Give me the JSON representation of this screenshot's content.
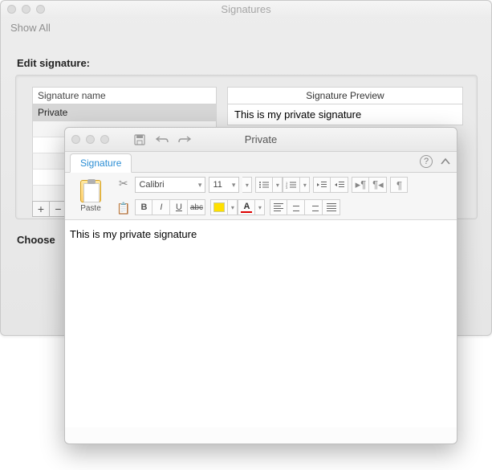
{
  "back": {
    "title": "Signatures",
    "show_all": "Show All",
    "edit_label": "Edit signature:",
    "sig_header": "Signature name",
    "sig_rows": [
      "Private"
    ],
    "add": "+",
    "remove": "−",
    "preview_header": "Signature Preview",
    "preview_body": "This is my private signature",
    "choose_label": "Choose"
  },
  "editor": {
    "title": "Private",
    "tab": "Signature",
    "paste": "Paste",
    "font": "Calibri",
    "size": "11",
    "bold": "B",
    "italic": "I",
    "underline": "U",
    "strike": "abc",
    "fontcolor": "A",
    "content": "This is my private signature"
  }
}
